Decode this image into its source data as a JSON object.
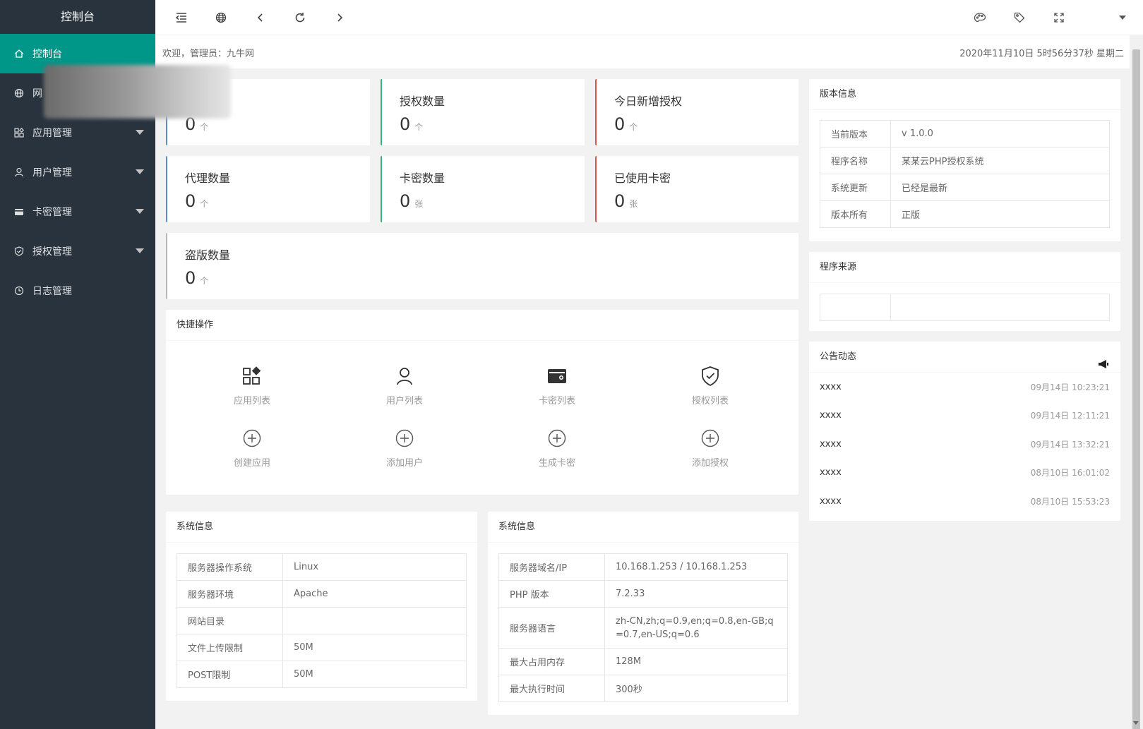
{
  "sidebar": {
    "title": "控制台",
    "items": [
      {
        "label": "控制台",
        "icon": "home-icon",
        "active": true
      },
      {
        "label": "网",
        "icon": "globe-icon"
      },
      {
        "label": "应用管理",
        "icon": "apps-icon",
        "expandable": true
      },
      {
        "label": "用户管理",
        "icon": "user-icon",
        "expandable": true
      },
      {
        "label": "卡密管理",
        "icon": "card-icon",
        "expandable": true
      },
      {
        "label": "授权管理",
        "icon": "shield-check-icon",
        "expandable": true
      },
      {
        "label": "日志管理",
        "icon": "clock-icon"
      }
    ]
  },
  "topbar": {
    "icons": [
      "menu-fold-icon",
      "globe-icon",
      "chevron-left-icon",
      "refresh-icon",
      "chevron-right-icon",
      "palette-icon",
      "tag-icon",
      "fullscreen-icon",
      "caret-down-icon"
    ]
  },
  "welcome": {
    "text": "欢迎，管理员：九牛网",
    "datetime": "2020年11月10日 5时56分37秒 星期二"
  },
  "stats": [
    {
      "title": "",
      "value": "0",
      "unit": "个",
      "color": "#5b8cc7"
    },
    {
      "title": "授权数量",
      "value": "0",
      "unit": "个",
      "color": "#2fb57a"
    },
    {
      "title": "今日新增授权",
      "value": "0",
      "unit": "个",
      "color": "#d9534f"
    },
    {
      "title": "代理数量",
      "value": "0",
      "unit": "个",
      "color": "#5b8cc7"
    },
    {
      "title": "卡密数量",
      "value": "0",
      "unit": "张",
      "color": "#2fb57a"
    },
    {
      "title": "已使用卡密",
      "value": "0",
      "unit": "张",
      "color": "#d9534f"
    },
    {
      "title": "盗版数量",
      "value": "0",
      "unit": "个",
      "color": "#b8b8b8"
    }
  ],
  "quick_actions": {
    "title": "快捷操作",
    "items": [
      {
        "label": "应用列表",
        "icon": "apps-icon"
      },
      {
        "label": "用户列表",
        "icon": "user-icon"
      },
      {
        "label": "卡密列表",
        "icon": "wallet-icon"
      },
      {
        "label": "授权列表",
        "icon": "shield-check-icon"
      },
      {
        "label": "创建应用",
        "icon": "plus-circle-icon"
      },
      {
        "label": "添加用户",
        "icon": "plus-circle-icon"
      },
      {
        "label": "生成卡密",
        "icon": "plus-circle-icon"
      },
      {
        "label": "添加授权",
        "icon": "plus-circle-icon"
      }
    ]
  },
  "system_info_1": {
    "title": "系统信息",
    "rows": [
      {
        "k": "服务器操作系统",
        "v": "Linux"
      },
      {
        "k": "服务器环境",
        "v": "Apache"
      },
      {
        "k": "网站目录",
        "v": ""
      },
      {
        "k": "文件上传限制",
        "v": "50M"
      },
      {
        "k": "POST限制",
        "v": "50M"
      }
    ]
  },
  "system_info_2": {
    "title": "系统信息",
    "rows": [
      {
        "k": "服务器域名/IP",
        "v": "10.168.1.253 / 10.168.1.253"
      },
      {
        "k": "PHP 版本",
        "v": "7.2.33"
      },
      {
        "k": "服务器语言",
        "v": "zh-CN,zh;q=0.9,en;q=0.8,en-GB;q=0.7,en-US;q=0.6"
      },
      {
        "k": "最大占用内存",
        "v": "128M"
      },
      {
        "k": "最大执行时间",
        "v": "300秒"
      }
    ]
  },
  "version_info": {
    "title": "版本信息",
    "rows": [
      {
        "k": "当前版本",
        "v": "v 1.0.0"
      },
      {
        "k": "程序名称",
        "v": "某某云PHP授权系统"
      },
      {
        "k": "系统更新",
        "v": "已经是最新"
      },
      {
        "k": "版本所有",
        "v": "正版"
      }
    ]
  },
  "program_source": {
    "title": "程序来源",
    "rows": [
      {
        "k": "",
        "v": ""
      }
    ]
  },
  "announcements": {
    "title": "公告动态",
    "icon": "megaphone-icon",
    "items": [
      {
        "text": "xxxx",
        "time": "09月14日 10:23:21"
      },
      {
        "text": "xxxx",
        "time": "09月14日 12:11:21"
      },
      {
        "text": "xxxx",
        "time": "09月14日 13:32:21"
      },
      {
        "text": "xxxx",
        "time": "08月10日 16:01:02"
      },
      {
        "text": "xxxx",
        "time": "08月10日 15:53:23"
      }
    ]
  }
}
